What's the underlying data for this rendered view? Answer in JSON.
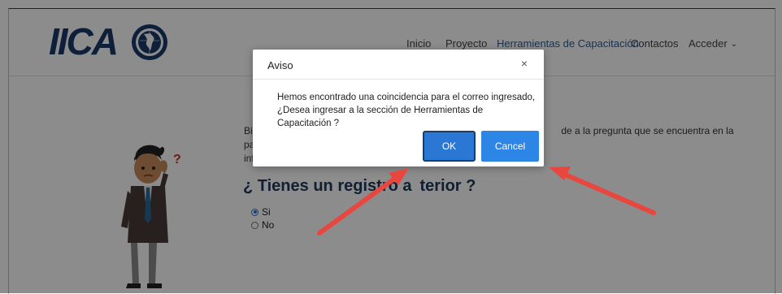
{
  "header": {
    "logo_text": "IICA",
    "nav": [
      {
        "label": "Inicio"
      },
      {
        "label": "Proyecto"
      },
      {
        "label": "Herramientas de Capacitación"
      },
      {
        "label": "Contactos"
      },
      {
        "label": "Acceder"
      }
    ]
  },
  "main": {
    "intro_line1_left": "Bie",
    "intro_line1_right": "de a la pregunta que se encuentra en la parte",
    "intro_line2_left": "inf",
    "question_left": "¿ Tienes un registro a",
    "question_right": "terior ?",
    "options": [
      {
        "label": "Si",
        "checked": true
      },
      {
        "label": "No",
        "checked": false
      }
    ]
  },
  "modal": {
    "title": "Aviso",
    "close_symbol": "×",
    "message_line1": "Hemos encontrado una coincidencia para el correo ingresado,",
    "message_line2": "¿Desea ingresar a la sección de Herramientas de Capacitación ?",
    "ok_label": "OK",
    "cancel_label": "Cancel"
  },
  "colors": {
    "accent": "#2d7fe0",
    "nav_active": "#2a5d9a",
    "annotation_arrow": "#e8473f"
  }
}
